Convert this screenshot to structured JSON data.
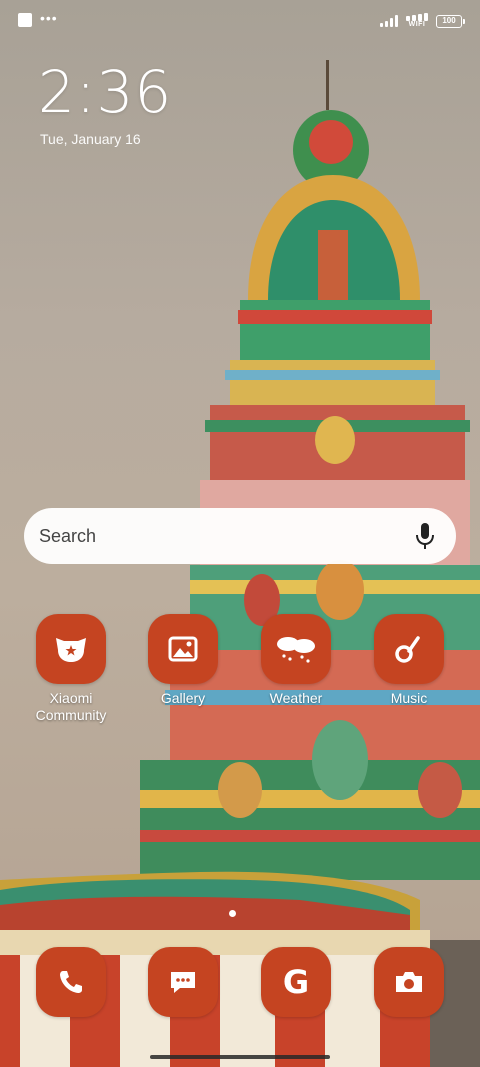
{
  "status_bar": {
    "wifi_label": "WIFI",
    "battery": "100"
  },
  "lockscreen": {
    "time": "2:36",
    "date": "Tue, January 16"
  },
  "search": {
    "placeholder": "Search"
  },
  "apps": [
    {
      "label": "Xiaomi Community",
      "icon": "xiaomi-community-icon"
    },
    {
      "label": "Gallery",
      "icon": "gallery-icon"
    },
    {
      "label": "Weather",
      "icon": "weather-icon"
    },
    {
      "label": "Music",
      "icon": "music-icon"
    }
  ],
  "dock": [
    {
      "icon": "phone-icon"
    },
    {
      "icon": "messages-icon"
    },
    {
      "icon": "google-icon",
      "glyph": "G"
    },
    {
      "icon": "camera-icon"
    }
  ],
  "colors": {
    "icon_background": "#c54421"
  }
}
